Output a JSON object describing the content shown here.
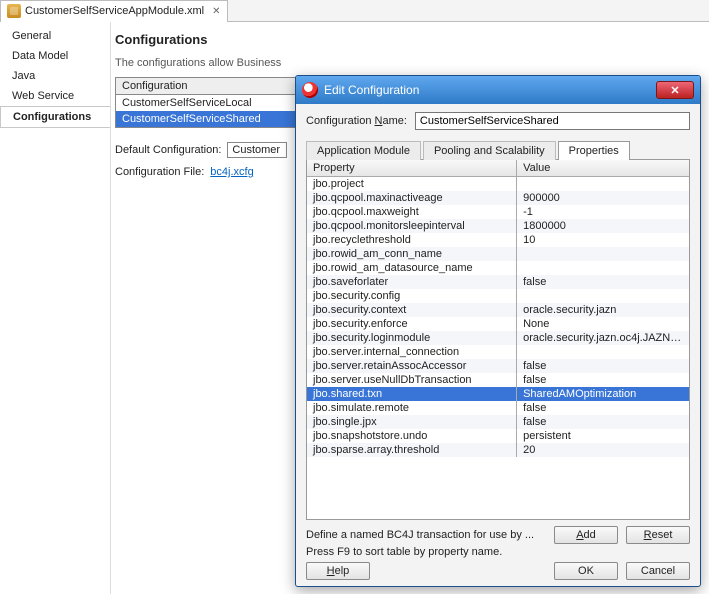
{
  "tab": {
    "filename": "CustomerSelfServiceAppModule.xml"
  },
  "sidenav": {
    "items": [
      "General",
      "Data Model",
      "Java",
      "Web Service",
      "Configurations"
    ],
    "selected_index": 4
  },
  "page": {
    "heading": "Configurations",
    "description": "The configurations allow Business",
    "config_header": "Configuration",
    "configs": [
      "CustomerSelfServiceLocal",
      "CustomerSelfServiceShared"
    ],
    "selected_config_index": 1,
    "default_label": "Default Configuration:",
    "default_value": "Customer",
    "file_label": "Configuration File:",
    "file_link": "bc4j.xcfg"
  },
  "dialog": {
    "title": "Edit Configuration",
    "name_label": "Configuration Name:",
    "name_value": "CustomerSelfServiceShared",
    "tabs": [
      "Application Module",
      "Pooling and Scalability",
      "Properties"
    ],
    "active_tab_index": 2,
    "col_property": "Property",
    "col_value": "Value",
    "rows": [
      {
        "p": "jbo.project",
        "v": ""
      },
      {
        "p": "jbo.qcpool.maxinactiveage",
        "v": "900000"
      },
      {
        "p": "jbo.qcpool.maxweight",
        "v": "-1"
      },
      {
        "p": "jbo.qcpool.monitorsleepinterval",
        "v": "1800000"
      },
      {
        "p": "jbo.recyclethreshold",
        "v": "10"
      },
      {
        "p": "jbo.rowid_am_conn_name",
        "v": ""
      },
      {
        "p": "jbo.rowid_am_datasource_name",
        "v": ""
      },
      {
        "p": "jbo.saveforlater",
        "v": "false"
      },
      {
        "p": "jbo.security.config",
        "v": ""
      },
      {
        "p": "jbo.security.context",
        "v": "oracle.security.jazn"
      },
      {
        "p": "jbo.security.enforce",
        "v": "None"
      },
      {
        "p": "jbo.security.loginmodule",
        "v": "oracle.security.jazn.oc4j.JAZNUserM..."
      },
      {
        "p": "jbo.server.internal_connection",
        "v": ""
      },
      {
        "p": "jbo.server.retainAssocAccessor",
        "v": "false"
      },
      {
        "p": "jbo.server.useNullDbTransaction",
        "v": "false"
      },
      {
        "p": "jbo.shared.txn",
        "v": "SharedAMOptimization"
      },
      {
        "p": "jbo.simulate.remote",
        "v": "false"
      },
      {
        "p": "jbo.single.jpx",
        "v": "false"
      },
      {
        "p": "jbo.snapshotstore.undo",
        "v": "persistent"
      },
      {
        "p": "jbo.sparse.array.threshold",
        "v": "20"
      }
    ],
    "selected_row_index": 15,
    "hint1": "Define a named BC4J transaction for use by ...",
    "hint2": "Press F9 to sort table by property name.",
    "btn_add": "Add",
    "btn_reset": "Reset",
    "btn_help": "Help",
    "btn_ok": "OK",
    "btn_cancel": "Cancel"
  }
}
